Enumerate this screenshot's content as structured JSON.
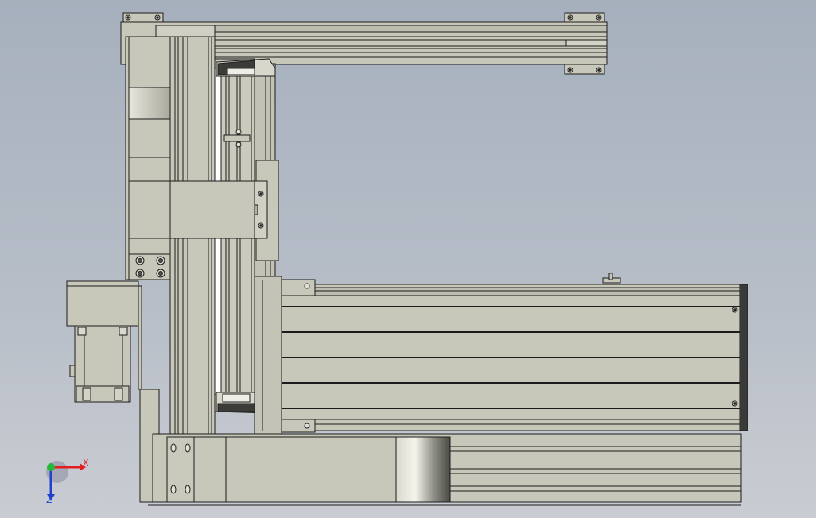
{
  "viewport": {
    "background_top": "#a6b0bd",
    "background_bottom": "#c9ccd2",
    "part_fill": "#c7c7ba",
    "part_shade": "#b9b9ab",
    "edge_color": "#1c1c1c"
  },
  "triad": {
    "x_label": "X",
    "z_label": "Z",
    "x_color": "#e02020",
    "y_color": "#22b83a",
    "z_color": "#2040d0"
  }
}
